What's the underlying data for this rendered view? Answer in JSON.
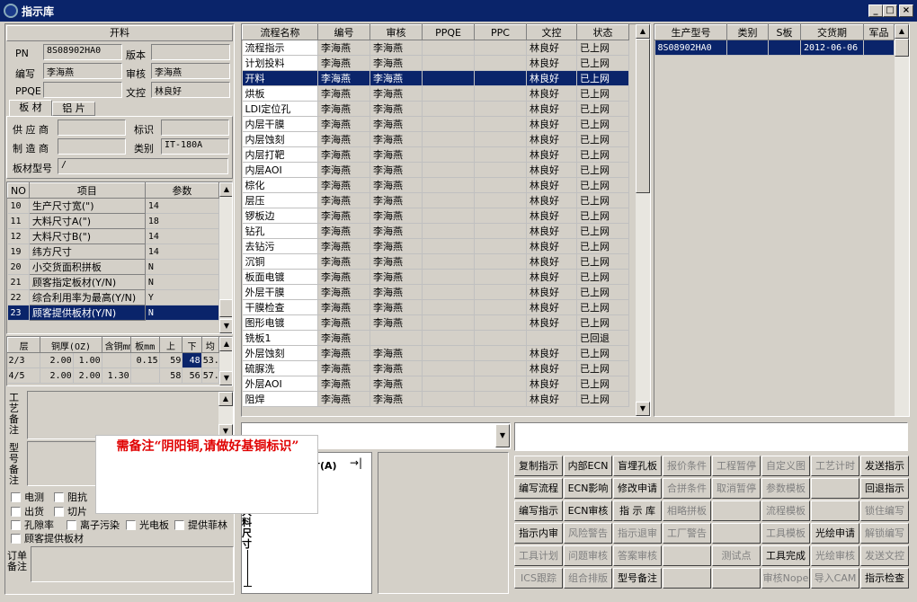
{
  "window": {
    "title": "指示库",
    "min": "_",
    "max": "□",
    "close": "×"
  },
  "left": {
    "section": "开料",
    "pn_label": "PN",
    "pn": "8S08902HA0",
    "version_label": "版本",
    "version": "",
    "author_label": "编写",
    "author": "李海燕",
    "review_label": "审核",
    "review": "李海燕",
    "ppqe_label": "PPQE",
    "ppqe": "",
    "doc_label": "文控",
    "doc": "林良好",
    "tabs": [
      "板 材",
      "铝 片"
    ],
    "supplier_label": "供 应 商",
    "supplier": "",
    "mark_label": "标识",
    "mark": "",
    "maker_label": "制 造 商",
    "maker": "",
    "type_label": "类别",
    "type": "IT-180A",
    "model_label": "板材型号",
    "model": "/",
    "params_headers": [
      "NO",
      "项目",
      "参数"
    ],
    "params": [
      {
        "no": "10",
        "item": "生产尺寸宽(\")",
        "val": "14"
      },
      {
        "no": "11",
        "item": "大料尺寸A(\")",
        "val": "18"
      },
      {
        "no": "12",
        "item": "大料尺寸B(\")",
        "val": "14"
      },
      {
        "no": "19",
        "item": "纬方尺寸",
        "val": "14"
      },
      {
        "no": "20",
        "item": "小交货面积拼板",
        "val": "N"
      },
      {
        "no": "21",
        "item": "顾客指定板材(Y/N)",
        "val": "N"
      },
      {
        "no": "22",
        "item": "综合利用率为最高(Y/N)",
        "val": "Y"
      },
      {
        "no": "23",
        "item": "顾客提供板材(Y/N)",
        "val": "N"
      }
    ],
    "layer_headers": [
      "层",
      "铜厚(OZ)",
      "含铜mm",
      "板mm",
      "上",
      "下",
      "均"
    ],
    "layers": [
      {
        "c": [
          "2/3",
          "2.00",
          "1.00",
          "",
          "0.15",
          "59",
          "48",
          "53."
        ]
      },
      {
        "c": [
          "4/5",
          "2.00",
          "2.00",
          "1.30",
          "",
          "58",
          "56",
          "57."
        ]
      }
    ],
    "remark1_label": "工艺备注",
    "remark2_label": "型号备注",
    "checks": [
      "电测",
      "阻抗",
      "出货",
      "切片",
      "孔隙率",
      "离子污染",
      "光电板",
      "提供菲林",
      "顾客提供板材"
    ],
    "order_label": "订单备注"
  },
  "center": {
    "headers": [
      "流程名称",
      "编号",
      "审核",
      "PPQE",
      "PPC",
      "文控",
      "状态"
    ],
    "rows": [
      [
        "流程指示",
        "李海燕",
        "李海燕",
        "",
        "",
        "林良好",
        "已上网"
      ],
      [
        "计划投料",
        "李海燕",
        "李海燕",
        "",
        "",
        "林良好",
        "已上网"
      ],
      [
        "开料",
        "李海燕",
        "李海燕",
        "",
        "",
        "林良好",
        "已上网"
      ],
      [
        "烘板",
        "李海燕",
        "李海燕",
        "",
        "",
        "林良好",
        "已上网"
      ],
      [
        "LDI定位孔",
        "李海燕",
        "李海燕",
        "",
        "",
        "林良好",
        "已上网"
      ],
      [
        "内层干膜",
        "李海燕",
        "李海燕",
        "",
        "",
        "林良好",
        "已上网"
      ],
      [
        "内层蚀刻",
        "李海燕",
        "李海燕",
        "",
        "",
        "林良好",
        "已上网"
      ],
      [
        "内层打靶",
        "李海燕",
        "李海燕",
        "",
        "",
        "林良好",
        "已上网"
      ],
      [
        "内层AOI",
        "李海燕",
        "李海燕",
        "",
        "",
        "林良好",
        "已上网"
      ],
      [
        "棕化",
        "李海燕",
        "李海燕",
        "",
        "",
        "林良好",
        "已上网"
      ],
      [
        "层压",
        "李海燕",
        "李海燕",
        "",
        "",
        "林良好",
        "已上网"
      ],
      [
        "锣板边",
        "李海燕",
        "李海燕",
        "",
        "",
        "林良好",
        "已上网"
      ],
      [
        "钻孔",
        "李海燕",
        "李海燕",
        "",
        "",
        "林良好",
        "已上网"
      ],
      [
        "去钻污",
        "李海燕",
        "李海燕",
        "",
        "",
        "林良好",
        "已上网"
      ],
      [
        "沉铜",
        "李海燕",
        "李海燕",
        "",
        "",
        "林良好",
        "已上网"
      ],
      [
        "板面电镀",
        "李海燕",
        "李海燕",
        "",
        "",
        "林良好",
        "已上网"
      ],
      [
        "外层干膜",
        "李海燕",
        "李海燕",
        "",
        "",
        "林良好",
        "已上网"
      ],
      [
        "干膜检查",
        "李海燕",
        "李海燕",
        "",
        "",
        "林良好",
        "已上网"
      ],
      [
        "图形电镀",
        "李海燕",
        "李海燕",
        "",
        "",
        "林良好",
        "已上网"
      ],
      [
        "铣板1",
        "李海燕",
        "",
        "",
        "",
        "",
        "已回退"
      ],
      [
        "外层蚀刻",
        "李海燕",
        "李海燕",
        "",
        "",
        "林良好",
        "已上网"
      ],
      [
        "硫脲洗",
        "李海燕",
        "李海燕",
        "",
        "",
        "林良好",
        "已上网"
      ],
      [
        "外层AOI",
        "李海燕",
        "李海燕",
        "",
        "",
        "林良好",
        "已上网"
      ],
      [
        "阻焊",
        "李海燕",
        "李海燕",
        "",
        "",
        "林良好",
        "已上网"
      ]
    ]
  },
  "right": {
    "headers": [
      "生产型号",
      "类别",
      "S板",
      "交货期",
      "军品"
    ],
    "rows": [
      [
        "8S08902HA0",
        "",
        "",
        "2012-06-06",
        ""
      ]
    ]
  },
  "popup": {
    "text": "需备注“阴阳铜,请做好基铜标识”"
  },
  "drawing": {
    "label_a": "寸(A)",
    "label_v": "大料尺寸"
  },
  "buttons": [
    [
      "复制指示",
      "内部ECN",
      "盲埋孔板",
      "报价条件",
      "工程暂停",
      "自定义图",
      "工艺计时",
      "发送指示"
    ],
    [
      "编写流程",
      "ECN影响",
      "修改申请",
      "合拼条件",
      "取消暂停",
      "参数模板",
      "",
      "回退指示"
    ],
    [
      "编写指示",
      "ECN审核",
      "指 示 库",
      "相略拼板",
      "",
      "流程模板",
      "",
      "锁住编写"
    ],
    [
      "指示内审",
      "风险警告",
      "指示退审",
      "工厂警告",
      "",
      "工具模板",
      "光绘申请",
      "解锁编写"
    ],
    [
      "工具计划",
      "问题审核",
      "答案审核",
      "",
      "测试点",
      "工具完成",
      "光绘审核",
      "发送文控"
    ],
    [
      "ICS跟踪",
      "组合排版",
      "型号备注",
      "",
      "",
      "审核Nope",
      "导入CAM",
      "指示检查"
    ]
  ],
  "buttons_disabled": [
    [
      false,
      false,
      false,
      true,
      true,
      true,
      true,
      false
    ],
    [
      false,
      false,
      false,
      true,
      true,
      true,
      true,
      false
    ],
    [
      false,
      false,
      false,
      true,
      true,
      true,
      true,
      true
    ],
    [
      false,
      true,
      true,
      true,
      true,
      true,
      false,
      true
    ],
    [
      true,
      true,
      true,
      true,
      true,
      false,
      true,
      true
    ],
    [
      true,
      true,
      false,
      true,
      true,
      true,
      true,
      false
    ]
  ]
}
